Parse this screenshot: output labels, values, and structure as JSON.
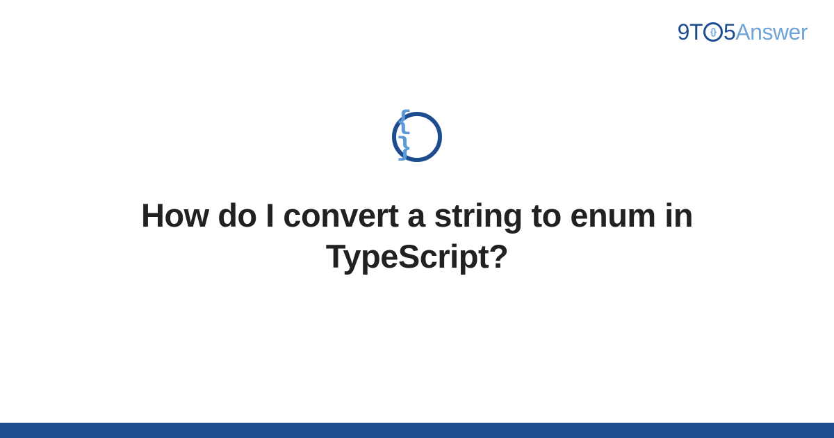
{
  "header": {
    "logo": {
      "part1": "9T",
      "circle_inner": "{}",
      "part2": "5",
      "part3": "Answer"
    }
  },
  "category": {
    "icon_glyph": "{ }",
    "icon_name": "code-braces-icon"
  },
  "main": {
    "title": "How do I convert a string to enum in TypeScript?"
  },
  "colors": {
    "primary_dark": "#1d4d8f",
    "primary_light": "#6fa4d8",
    "brace_color": "#5a9bd8",
    "text": "#212121"
  }
}
